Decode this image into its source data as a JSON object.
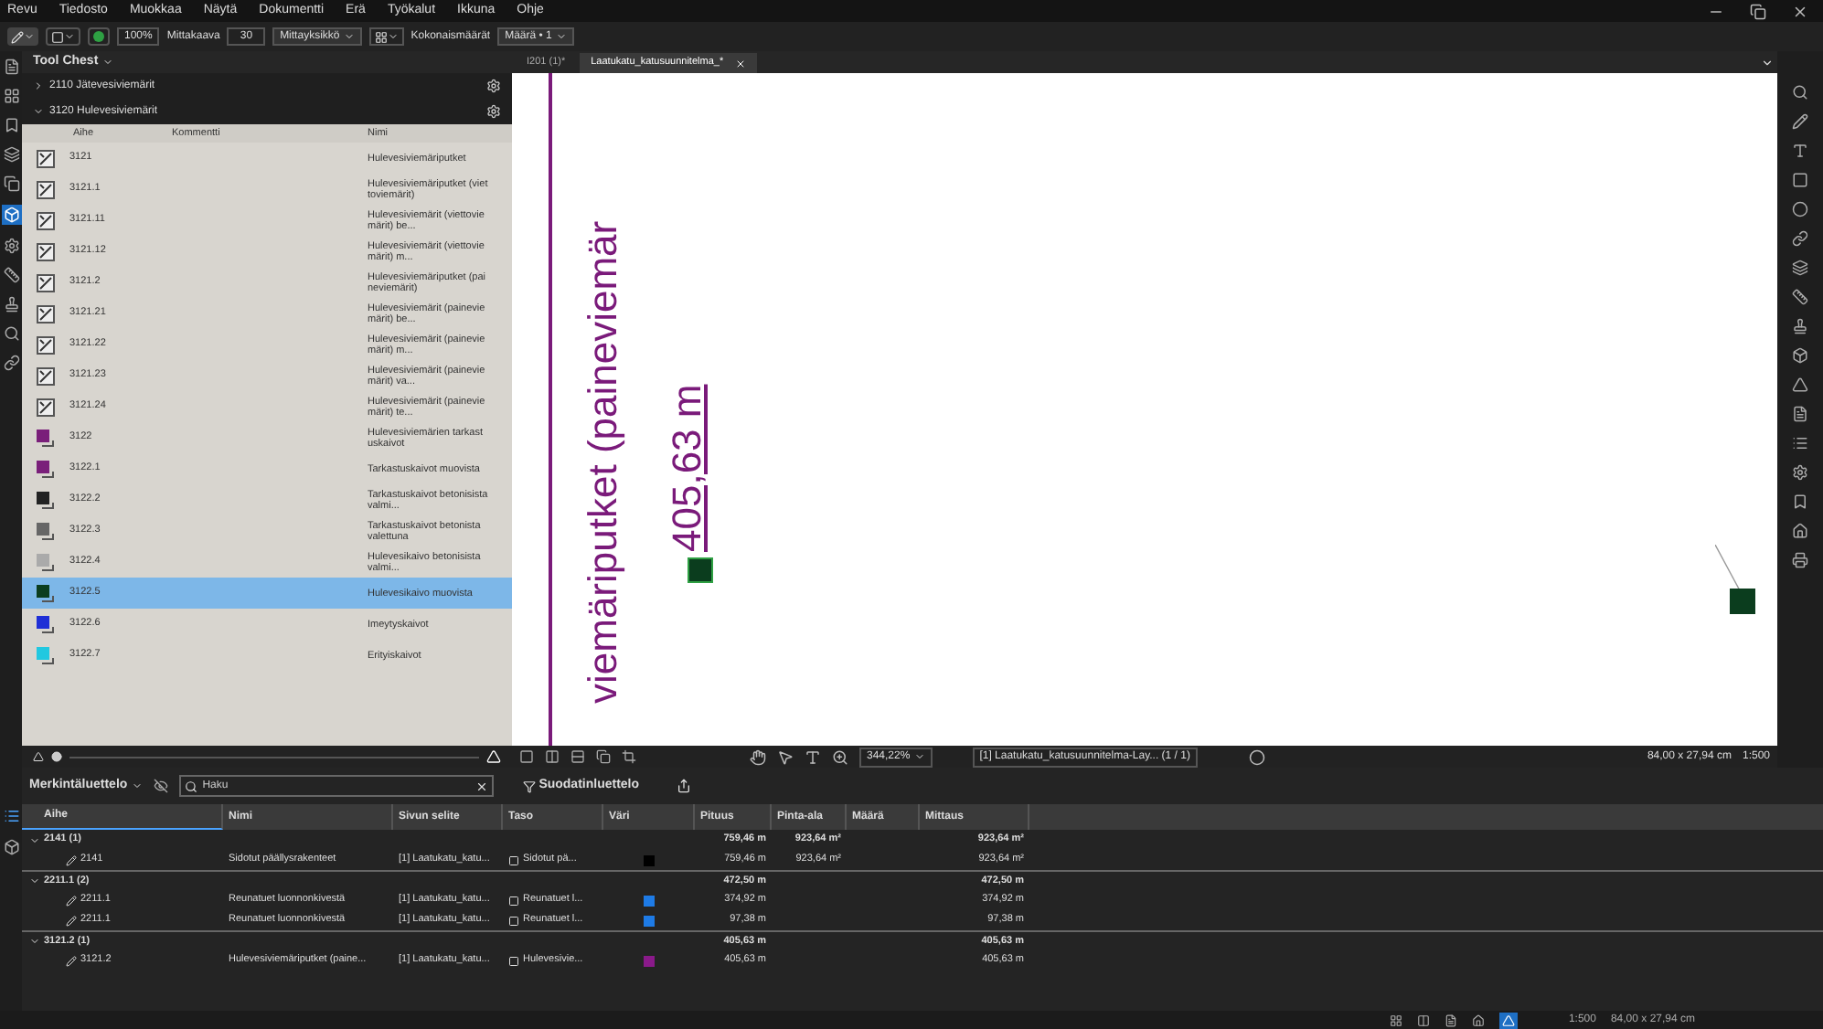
{
  "menu": [
    "Revu",
    "Tiedosto",
    "Muokkaa",
    "Näytä",
    "Dokumentti",
    "Erä",
    "Työkalut",
    "Ikkuna",
    "Ohje"
  ],
  "toolbar": {
    "zoom": "100%",
    "scale_label": "Mittakaava",
    "scale_value": "30",
    "unit": "Mittayksikkö",
    "totals_label": "Kokonaismäärät",
    "totals_value": "Määrä • 1"
  },
  "tool_chest": {
    "title": "Tool Chest",
    "sections": [
      {
        "label": "2110 Jätevesiviemärit",
        "expanded": false
      },
      {
        "label": "3120 Hulevesiviemärit",
        "expanded": true
      }
    ],
    "columns": [
      "Aihe",
      "Kommentti",
      "Nimi"
    ],
    "rows": [
      {
        "kind": "markup",
        "code": "3121",
        "name": "Hulevesiviemäriputket",
        "selected": false
      },
      {
        "kind": "markup",
        "code": "3121.1",
        "name": "Hulevesiviemäriputket (viettoviemärit)",
        "selected": false
      },
      {
        "kind": "markup",
        "code": "3121.11",
        "name": "Hulevesiviemärit (viettoviemärit) be...",
        "selected": false
      },
      {
        "kind": "markup",
        "code": "3121.12",
        "name": "Hulevesiviemärit (viettoviemärit) m...",
        "selected": false
      },
      {
        "kind": "markup",
        "code": "3121.2",
        "name": "Hulevesiviemäriputket (paineviemärit)",
        "selected": false
      },
      {
        "kind": "markup",
        "code": "3121.21",
        "name": "Hulevesiviemärit (paineviemärit) be...",
        "selected": false
      },
      {
        "kind": "markup",
        "code": "3121.22",
        "name": "Hulevesiviemärit (paineviemärit) m...",
        "selected": false
      },
      {
        "kind": "markup",
        "code": "3121.23",
        "name": "Hulevesiviemärit (paineviemärit) va...",
        "selected": false
      },
      {
        "kind": "markup",
        "code": "3121.24",
        "name": "Hulevesiviemärit (paineviemärit) te...",
        "selected": false
      },
      {
        "kind": "swatch",
        "color": "#7a1f7a",
        "code": "3122",
        "name": "Hulevesiviemärien tarkastuskaivot",
        "selected": false
      },
      {
        "kind": "swatch",
        "color": "#7a1f7a",
        "code": "3122.1",
        "name": "Tarkastuskaivot muovista",
        "selected": false
      },
      {
        "kind": "swatch",
        "color": "#222222",
        "code": "3122.2",
        "name": "Tarkastuskaivot betonisista valmi...",
        "selected": false
      },
      {
        "kind": "swatch",
        "color": "#666666",
        "code": "3122.3",
        "name": "Tarkastuskaivot betonista valettuna",
        "selected": false
      },
      {
        "kind": "swatch",
        "color": "#aaaaaa",
        "code": "3122.4",
        "name": "Hulevesikaivo betonisista valmi...",
        "selected": false
      },
      {
        "kind": "swatch",
        "color": "#0b3d1e",
        "code": "3122.5",
        "name": "Hulevesikaivo muovista",
        "selected": true
      },
      {
        "kind": "swatch",
        "color": "#1f2fd6",
        "code": "3122.6",
        "name": "Imeytyskaivot",
        "selected": false
      },
      {
        "kind": "swatch",
        "color": "#22c8e0",
        "code": "3122.7",
        "name": "Erityiskaivot",
        "selected": false
      }
    ]
  },
  "tabs": [
    {
      "label": "I201 (1)*",
      "selected": false
    },
    {
      "label": "Laatukatu_katusuunnitelma_*",
      "selected": true
    }
  ],
  "canvas": {
    "pipe_label": "viemäriputket (paineviemär",
    "length_label": "405,63 m"
  },
  "canvas_bar": {
    "zoom": "344,22%",
    "page": "[1] Laatukatu_katusuunnitelma-Lay... (1 / 1)",
    "size": "84,00 x 27,94 cm",
    "scale": "1:500"
  },
  "markups": {
    "title": "Merkintäluettelo",
    "search_placeholder": "Haku",
    "filter": "Suodatinluettelo",
    "columns": [
      "Aihe",
      "Nimi",
      "Sivun selite",
      "Taso",
      "Väri",
      "Pituus",
      "Pinta-ala",
      "Määrä",
      "Mittaus"
    ],
    "rows": [
      {
        "kind": "group",
        "expanded": true,
        "aihe": "2141 (1)",
        "pituus": "759,46 m",
        "pinta_ala": "923,64 m²",
        "mittaus": "923,64 m²"
      },
      {
        "kind": "item",
        "aihe": "2141",
        "nimi": "Sidotut päällysrakenteet",
        "sivu": "[1] Laatukatu_katu...",
        "taso": "Sidotut pä...",
        "color": "#000000",
        "pituus": "759,46 m",
        "pinta_ala": "923,64 m²",
        "mittaus": "923,64 m²"
      },
      {
        "kind": "group",
        "expanded": true,
        "aihe": "2211.1 (2)",
        "pituus": "472,50 m",
        "mittaus": "472,50 m"
      },
      {
        "kind": "item",
        "aihe": "2211.1",
        "nimi": "Reunatuet luonnonkivestä",
        "sivu": "[1] Laatukatu_katu...",
        "taso": "Reunatuet l...",
        "color": "#1e7be6",
        "pituus": "374,92 m",
        "mittaus": "374,92 m"
      },
      {
        "kind": "item",
        "aihe": "2211.1",
        "nimi": "Reunatuet luonnonkivestä",
        "sivu": "[1] Laatukatu_katu...",
        "taso": "Reunatuet l...",
        "color": "#1e7be6",
        "pituus": "97,38 m",
        "mittaus": "97,38 m"
      },
      {
        "kind": "group",
        "expanded": true,
        "aihe": "3121.2 (1)",
        "pituus": "405,63 m",
        "mittaus": "405,63 m"
      },
      {
        "kind": "item",
        "aihe": "3121.2",
        "nimi": "Hulevesiviemäriputket (paine...",
        "sivu": "[1] Laatukatu_katu...",
        "taso": "Hulevesivie...",
        "color": "#8a1a8a",
        "pituus": "405,63 m",
        "mittaus": "405,63 m"
      }
    ]
  },
  "status": {
    "scale": "1:500",
    "size": "84,00 x 27,94 cm"
  }
}
